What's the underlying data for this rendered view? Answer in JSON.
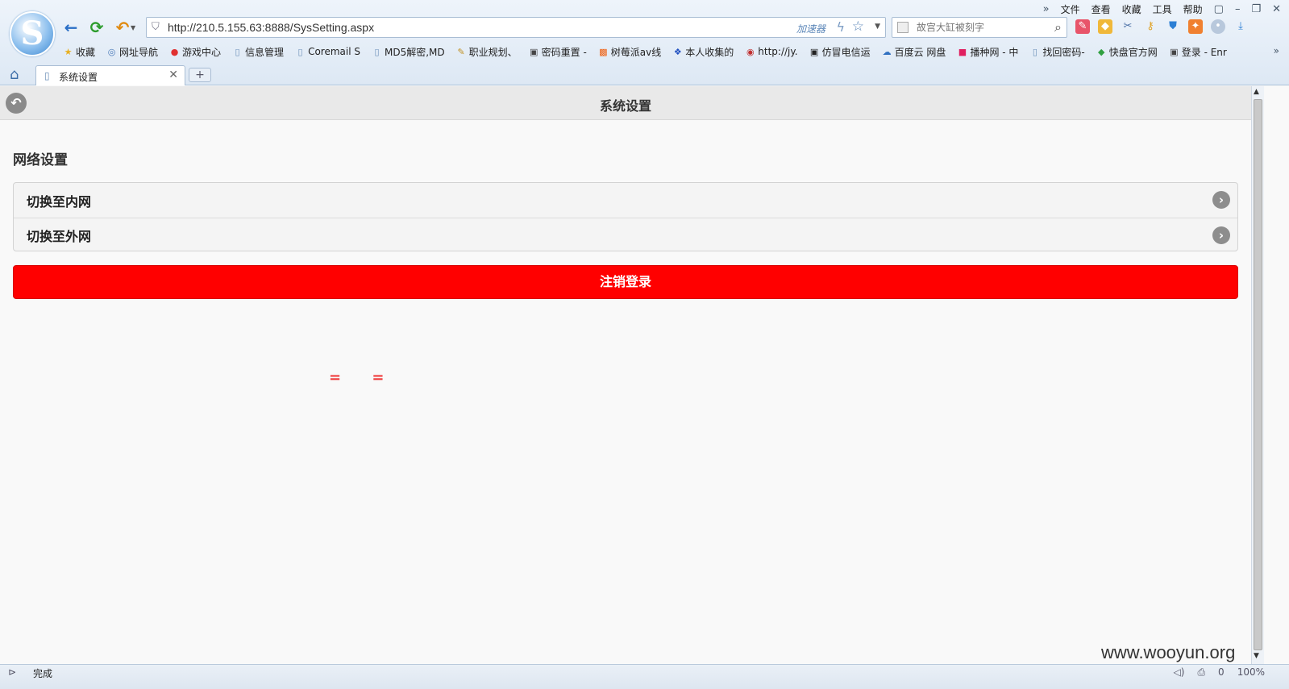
{
  "browser": {
    "logo_letter": "S",
    "menu": [
      "文件",
      "查看",
      "收藏",
      "工具",
      "帮助"
    ],
    "window_controls": [
      "»",
      "▢",
      "–",
      "❐",
      "✕"
    ],
    "url": "http://210.5.155.63:8888/SysSetting.aspx",
    "accelerator_label": "加速器",
    "search_placeholder": "故宫大缸被刻字",
    "bookmarks": [
      {
        "label": "收藏",
        "icon": "star-icon"
      },
      {
        "label": "网址导航",
        "icon": "globe-icon"
      },
      {
        "label": "游戏中心",
        "icon": "game-icon"
      },
      {
        "label": "信息管理",
        "icon": "page-icon"
      },
      {
        "label": "Coremail S",
        "icon": "page-icon"
      },
      {
        "label": "MD5解密,MD",
        "icon": "page-icon"
      },
      {
        "label": "职业规划、",
        "icon": "pen-icon"
      },
      {
        "label": "密码重置 -",
        "icon": "image-icon"
      },
      {
        "label": "树莓派av线",
        "icon": "taobao-icon"
      },
      {
        "label": "本人收集的",
        "icon": "paw-icon"
      },
      {
        "label": "http://jy.",
        "icon": "seal-icon"
      },
      {
        "label": "仿冒电信运",
        "icon": "image-icon"
      },
      {
        "label": "百度云 网盘",
        "icon": "cloud-icon"
      },
      {
        "label": "播种网 - 中",
        "icon": "bo-icon"
      },
      {
        "label": "找回密码-",
        "icon": "page-icon"
      },
      {
        "label": "快盘官方网",
        "icon": "diamond-icon"
      },
      {
        "label": "登录 - Enr",
        "icon": "image-icon"
      }
    ],
    "bookmarks_more": "»",
    "tab": {
      "label": "系统设置"
    }
  },
  "page": {
    "header_title": "系统设置",
    "section_title": "网络设置",
    "menu_items": [
      {
        "label": "切换至内网"
      },
      {
        "label": "切换至外网"
      }
    ],
    "logout_label": "注销登录",
    "red_marks": "= ="
  },
  "watermark": "www.wooyun.org",
  "status": {
    "text": "完成",
    "zoom": "100%",
    "count": "0"
  },
  "colors": {
    "logout_button": "#ff0000",
    "header_bg": "#e9e9e9",
    "page_bg": "#f9f9f9"
  }
}
